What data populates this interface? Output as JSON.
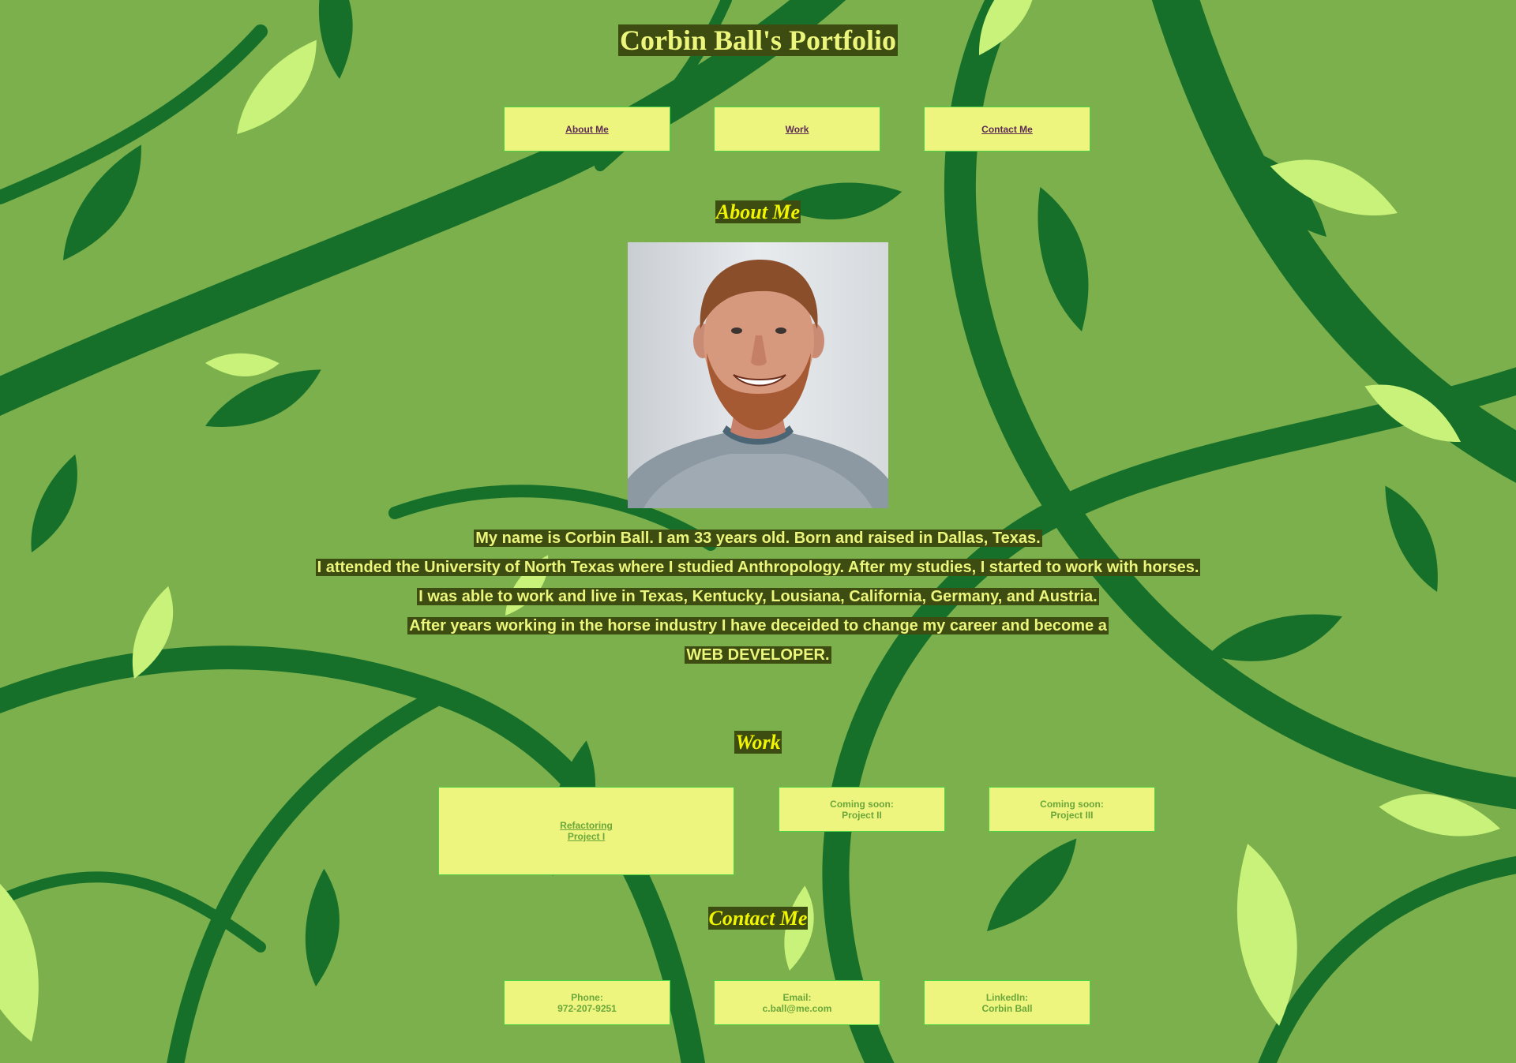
{
  "header": {
    "title": "Corbin Ball's Portfolio"
  },
  "nav": {
    "items": [
      {
        "label": "About Me"
      },
      {
        "label": "Work"
      },
      {
        "label": "Contact Me"
      }
    ]
  },
  "about": {
    "heading": "About Me",
    "lines": [
      "My name is Corbin Ball. I am 33 years old. Born and raised in Dallas, Texas.",
      "I attended the University of North Texas where I studied Anthropology. After my studies, I started to work with horses.",
      "I was able to work and live in Texas, Kentucky, Lousiana, California, Germany, and Austria.",
      "After years working in the horse industry I have deceided to change my career and become a",
      "WEB DEVELOPER."
    ]
  },
  "work": {
    "heading": "Work",
    "projects": [
      {
        "line1": "Refactoring",
        "line2": "Project I"
      },
      {
        "line1": "Coming soon:",
        "line2": "Project II"
      },
      {
        "line1": "Coming soon:",
        "line2": "Project III"
      }
    ]
  },
  "contact": {
    "heading": "Contact Me",
    "items": [
      {
        "label": "Phone:",
        "value": "972-207-9251"
      },
      {
        "label": "Email:",
        "value": "c.ball@me.com"
      },
      {
        "label": "LinkedIn:",
        "value": "Corbin Ball"
      }
    ]
  },
  "colors": {
    "background": "#7bb04d",
    "leaf_dark": "#17702a",
    "leaf_light": "#c8f27a",
    "text_highlight_bg": "#3d4c10",
    "text_color": "#ecf57c",
    "heading_color": "#f2f500",
    "box_bg": "#eef57e",
    "box_border": "#4ad446",
    "nav_link": "#5b2a55",
    "box_text": "#6aa63a"
  }
}
